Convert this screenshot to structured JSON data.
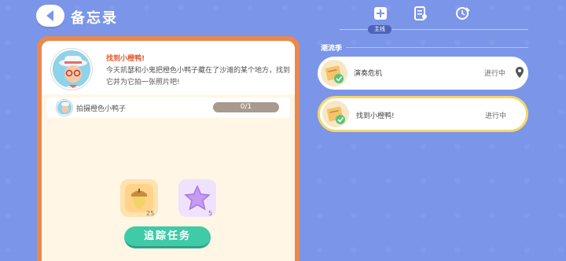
{
  "header": {
    "title": "备忘录"
  },
  "tabs": {
    "active_label": "主线",
    "icons": [
      "main-quest-icon",
      "notebook-icon",
      "clock-note-icon"
    ]
  },
  "quest": {
    "title": "找到小橙鸭!",
    "description": "今天凯瑟和小鬼把橙色小鸭子藏在了沙滩的某个地方，找到它并为它拍一张照片吧!",
    "task": {
      "label": "拍摄橙色小鸭子",
      "progress": "0/1"
    },
    "rewards": [
      {
        "icon": "acorn-icon",
        "count": "25"
      },
      {
        "icon": "star-icon",
        "count": "5"
      }
    ],
    "track_button": "追踪任务"
  },
  "right_panel": {
    "section_label": "潮流季",
    "cards": [
      {
        "label": "演奏危机",
        "status": "进行中",
        "has_pin": true
      },
      {
        "label": "找到小橙鸭!",
        "status": "进行中",
        "has_pin": false,
        "selected": true
      }
    ]
  },
  "colors": {
    "background": "#7b95e8",
    "panel_frame": "#e9894e",
    "accent_green": "#3fcaa8",
    "title_red": "#e05a2f",
    "selected_border": "#f3d76a"
  }
}
